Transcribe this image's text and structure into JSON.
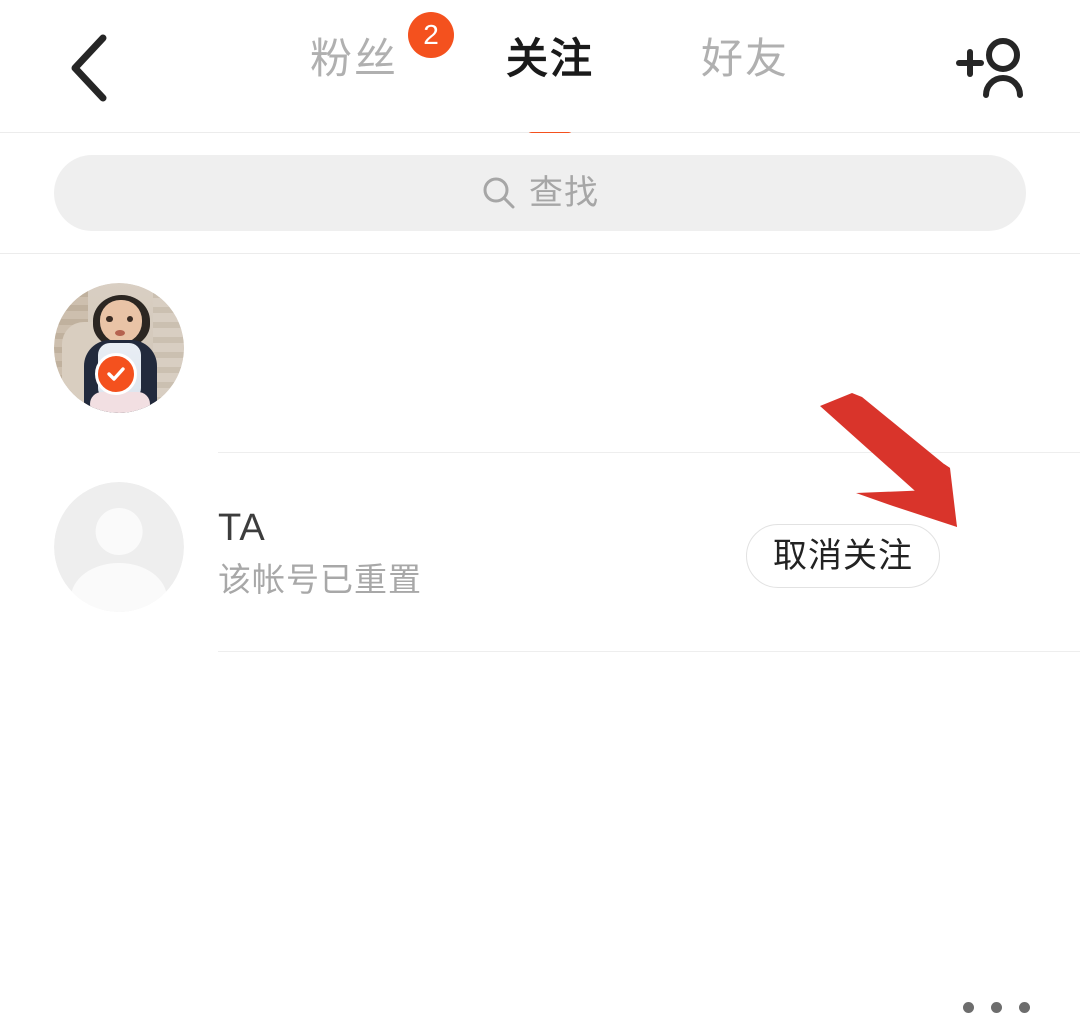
{
  "header": {
    "back_icon": "chevron-left-icon",
    "add_user_icon": "add-user-icon",
    "tabs": [
      {
        "label": "粉丝",
        "active": false,
        "badge": "2"
      },
      {
        "label": "关注",
        "active": true,
        "badge": null
      },
      {
        "label": "好友",
        "active": false,
        "badge": null
      }
    ]
  },
  "search": {
    "icon": "search-icon",
    "placeholder": "查找",
    "value": ""
  },
  "list": {
    "rows": [
      {
        "name": "",
        "subtitle": "",
        "avatar_type": "photo",
        "verified": true,
        "verified_icon": "check-badge-icon",
        "action_label": null,
        "more_icon": "more-horizontal-icon"
      },
      {
        "name": "TA",
        "subtitle": "该帐号已重置",
        "avatar_type": "default-person",
        "verified": false,
        "verified_icon": null,
        "action_label": "取消关注",
        "more_icon": "more-horizontal-icon"
      }
    ]
  },
  "annotation": {
    "arrow_icon": "red-arrow-down-right",
    "color": "#d9342b"
  },
  "colors": {
    "accent": "#f4511e",
    "text_primary": "#1a1a1a",
    "text_secondary": "#a8a8a8",
    "tab_inactive": "#b0b0b0",
    "search_bg": "#efefef",
    "separator": "#ececec",
    "annotation_red": "#d9342b"
  }
}
